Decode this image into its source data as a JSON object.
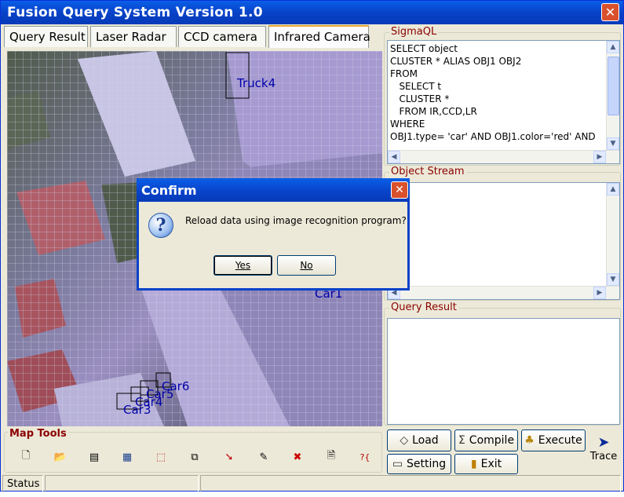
{
  "window": {
    "title": "Fusion Query System Version 1.0",
    "close": "✕"
  },
  "tabs": [
    {
      "label": "Query Result",
      "active": false
    },
    {
      "label": "Laser Radar",
      "active": false
    },
    {
      "label": "CCD camera",
      "active": false
    },
    {
      "label": "Infrared Camera",
      "active": true
    }
  ],
  "map": {
    "labels": {
      "truck4": "Truck4",
      "car1": "Car1",
      "car3": "Car3",
      "car4": "Car4",
      "car5": "Car5",
      "car6": "Car6"
    }
  },
  "sigmaql": {
    "title": "SigmaQL",
    "lines": [
      "SELECT object",
      "CLUSTER * ALIAS OBJ1 OBJ2",
      "FROM",
      "   SELECT t",
      "   CLUSTER *",
      "   FROM IR,CCD,LR",
      "WHERE",
      "OBJ1.type= 'car' AND OBJ1.color='red' AND"
    ]
  },
  "object_stream": {
    "title": "Object Stream"
  },
  "query_result": {
    "title": "Query Result"
  },
  "buttons": {
    "load": "Load",
    "compile": "Compile",
    "execute": "Execute",
    "setting": "Setting",
    "exit": "Exit",
    "trace": "Trace"
  },
  "map_tools": {
    "title": "Map Tools",
    "icons": [
      "new-icon",
      "open-icon",
      "save-icon",
      "grid-icon",
      "select-region-icon",
      "layers-icon",
      "pointer-icon",
      "edit-icon",
      "delete-icon",
      "document-icon",
      "help-icon"
    ]
  },
  "status": {
    "label": "Status"
  },
  "dialog": {
    "title": "Confirm",
    "message": "Reload data using image recognition program?",
    "yes": "Yes",
    "no": "No"
  },
  "colors": {
    "titlebar": "#0842c8",
    "accent_red": "#8b0000",
    "label_blue": "#0000aa"
  }
}
